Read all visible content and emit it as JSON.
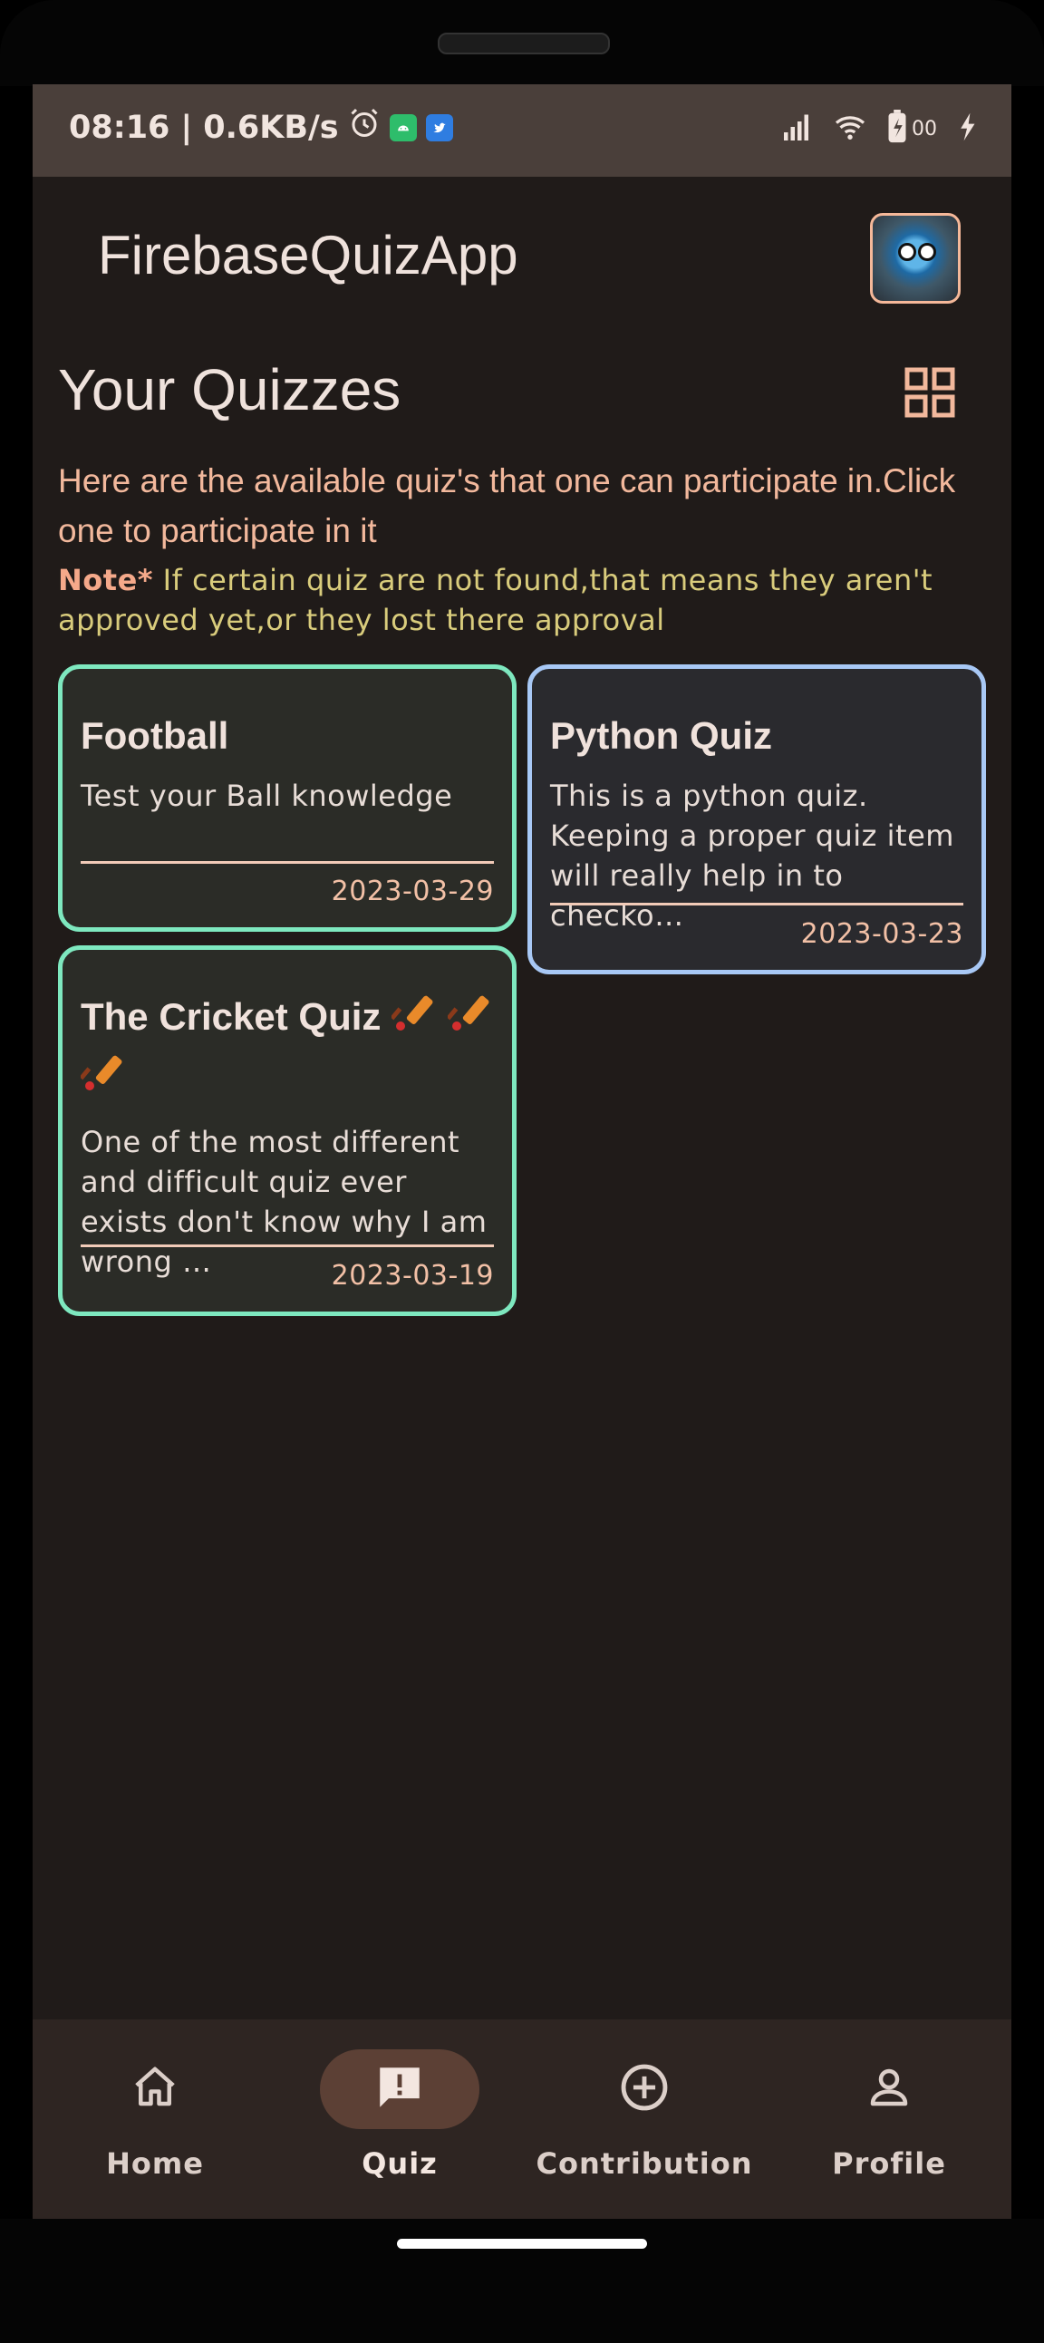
{
  "status_bar": {
    "time": "08:16",
    "separator": "|",
    "network_speed": "0.6KB/s",
    "battery_label": "00",
    "icons": [
      "alarm-icon",
      "android-app-icon",
      "twitter-icon",
      "signal-icon",
      "wifi-icon",
      "battery-icon",
      "charging-icon"
    ]
  },
  "app_bar": {
    "title": "FirebaseQuizApp",
    "avatar_icon": "avatar-robot-icon"
  },
  "main": {
    "section_title": "Your Quizzes",
    "view_toggle_icon": "grid-view-icon",
    "description": "Here are the available quiz's that one can participate in.Click one to participate in it",
    "note_label": "Note*",
    "note_text": " If certain quiz are not found,that means they aren't approved yet,or they lost there approval"
  },
  "quizzes": [
    {
      "title": "Football",
      "description": "Test your Ball knowledge",
      "date": "2023-03-29",
      "border_color": "#7ee8bf"
    },
    {
      "title": "Python Quiz",
      "description": "This is a python quiz.\nKeeping a proper quiz item will really help in to checko…",
      "date": "2023-03-23",
      "border_color": "#a8c8f5"
    },
    {
      "title": "The Cricket Quiz",
      "title_icons": [
        "cricket-bat-icon",
        "cricket-bat-icon",
        "cricket-bat-icon"
      ],
      "description": "One of the most different and difficult quiz ever exists don't know why I am wrong …",
      "date": "2023-03-19",
      "border_color": "#7ee8bf"
    }
  ],
  "bottom_nav": {
    "items": [
      {
        "label": "Home",
        "icon": "home-icon",
        "active": false
      },
      {
        "label": "Quiz",
        "icon": "quiz-icon",
        "active": true
      },
      {
        "label": "Contribution",
        "icon": "add-circle-icon",
        "active": false
      },
      {
        "label": "Profile",
        "icon": "profile-icon",
        "active": false
      }
    ]
  },
  "colors": {
    "background": "#201b19",
    "accent": "#f2b89c",
    "note_text": "#d9cc7c",
    "green_border": "#7ee8bf",
    "blue_border": "#a8c8f5"
  }
}
